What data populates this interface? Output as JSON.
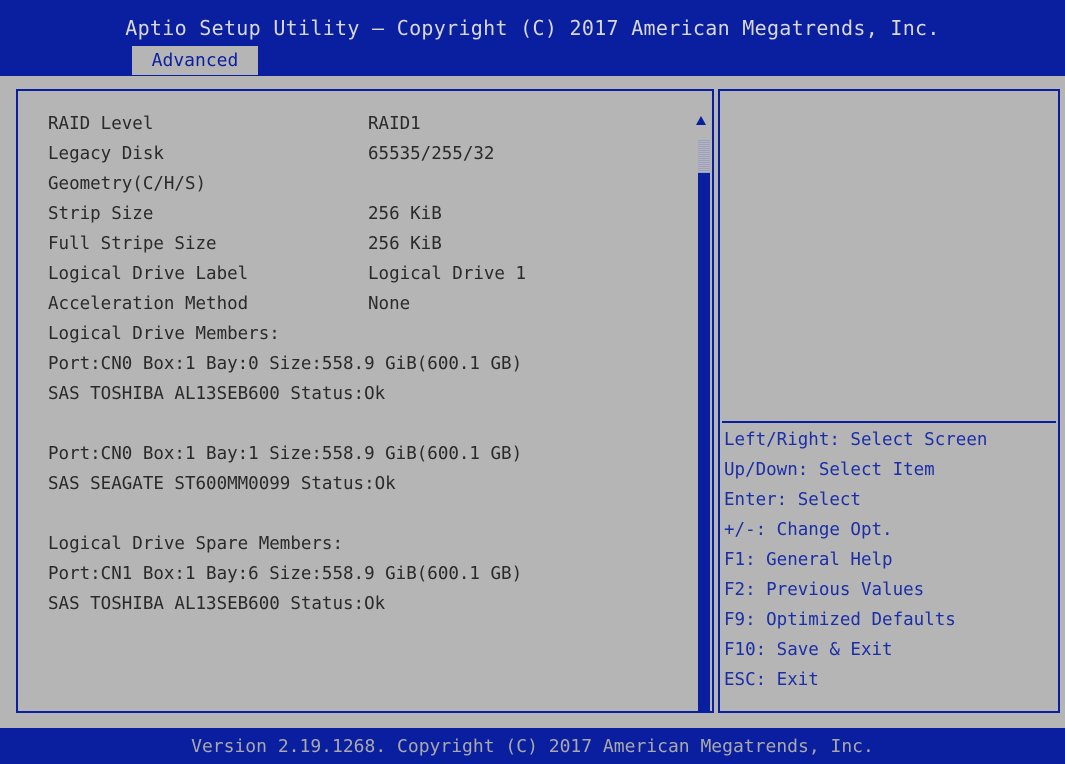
{
  "header": {
    "title": "Aptio Setup Utility – Copyright (C) 2017 American Megatrends, Inc.",
    "active_tab": "Advanced"
  },
  "details": [
    {
      "label": "RAID Level",
      "value": "RAID1"
    },
    {
      "label": "Legacy Disk",
      "value": "65535/255/32"
    },
    {
      "label": "Geometry(C/H/S)",
      "value": ""
    },
    {
      "label": "Strip Size",
      "value": "256 KiB"
    },
    {
      "label": "Full Stripe Size",
      "value": "256 KiB"
    },
    {
      "label": "Logical Drive Label",
      "value": "Logical Drive 1"
    },
    {
      "label": "Acceleration Method",
      "value": "None"
    },
    {
      "label": "Logical Drive Members:",
      "value": ""
    },
    {
      "label": "Port:CN0 Box:1 Bay:0 Size:558.9 GiB(600.1 GB)",
      "value": ""
    },
    {
      "label": "SAS TOSHIBA AL13SEB600 Status:Ok",
      "value": ""
    },
    {
      "label": "",
      "value": ""
    },
    {
      "label": "Port:CN0 Box:1 Bay:1 Size:558.9 GiB(600.1 GB)",
      "value": ""
    },
    {
      "label": "SAS SEAGATE ST600MM0099 Status:Ok",
      "value": ""
    },
    {
      "label": "",
      "value": ""
    },
    {
      "label": "Logical Drive Spare Members:",
      "value": ""
    },
    {
      "label": "Port:CN1 Box:1 Bay:6 Size:558.9 GiB(600.1 GB)",
      "value": ""
    },
    {
      "label": "SAS TOSHIBA AL13SEB600 Status:Ok",
      "value": ""
    }
  ],
  "help": [
    "Left/Right: Select Screen",
    "Up/Down: Select Item",
    "Enter: Select",
    "+/-: Change Opt.",
    "F1: General Help",
    "F2: Previous Values",
    "F9: Optimized Defaults",
    "F10: Save & Exit",
    "ESC: Exit"
  ],
  "footer": {
    "text": "Version 2.19.1268. Copyright (C) 2017 American Megatrends, Inc."
  },
  "colors": {
    "background_blue": "#0a1fa0",
    "panel_gray": "#b5b5b5",
    "help_text": "#1a2ea8"
  },
  "icons": {
    "scroll_up": "scroll-up-arrow-icon",
    "scroll_down": "scroll-down-arrow-icon"
  }
}
